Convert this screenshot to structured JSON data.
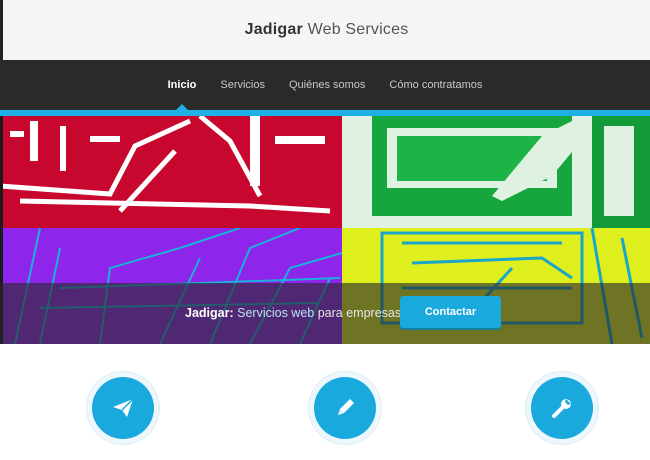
{
  "header": {
    "brand_bold": "Jadigar",
    "brand_rest": " Web Services"
  },
  "nav": {
    "items": [
      {
        "label": "Inicio",
        "active": true
      },
      {
        "label": "Servicios",
        "active": false
      },
      {
        "label": "Quiénes somos",
        "active": false
      },
      {
        "label": "Cómo contratamos",
        "active": false
      }
    ]
  },
  "hero": {
    "title_bold": "Jadigar:",
    "title_highlight": "Servicios web",
    "title_rest": " para empresas",
    "cta_label": "Contactar"
  },
  "features": [
    {
      "icon": "paper-plane-icon"
    },
    {
      "icon": "pencil-icon"
    },
    {
      "icon": "wrench-icon"
    }
  ],
  "colors": {
    "accent": "#1fb1e6",
    "nav_bg": "#2a2a2a"
  }
}
